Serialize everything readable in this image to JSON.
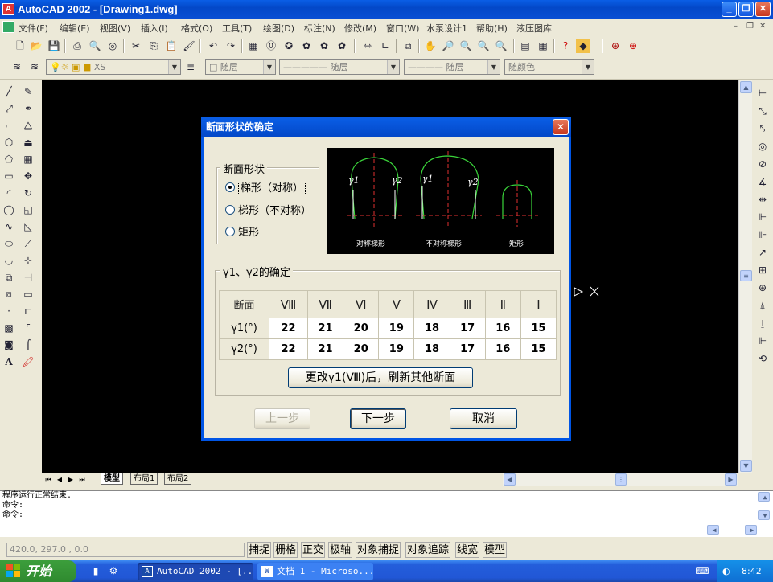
{
  "window": {
    "title": "AutoCAD 2002 - [Drawing1.dwg]",
    "app_icon": "A"
  },
  "menu": [
    "文件(F)",
    "编辑(E)",
    "视图(V)",
    "插入(I)",
    "格式(O)",
    "工具(T)",
    "绘图(D)",
    "标注(N)",
    "修改(M)",
    "窗口(W)",
    "水泵设计1",
    "帮助(H)",
    "液压图库"
  ],
  "layer_toolbar": {
    "layer_combo": "XS",
    "color_combo": "随层",
    "linetype_combo": "随层",
    "lineweight_combo": "随层",
    "plotstyle_combo": "随颜色"
  },
  "layout_tabs": [
    "模型",
    "布局1",
    "布局2"
  ],
  "command_lines": [
    "程序运行正常结束.",
    "命令:",
    "命令:"
  ],
  "status": {
    "coords": "420.0, 297.0 , 0.0",
    "toggles": [
      "捕捉",
      "栅格",
      "正交",
      "极轴",
      "对象捕捉",
      "对象追踪",
      "线宽",
      "模型"
    ]
  },
  "taskbar": {
    "start": "开始",
    "tasks": [
      "AutoCAD 2002 - [...",
      "文档 1 - Microso..."
    ],
    "clock": "8:42"
  },
  "dialog": {
    "title": "断面形状的确定",
    "shape_group": "断面形状",
    "options": [
      "梯形（对称）",
      "梯形（不对称）",
      "矩形"
    ],
    "selected_index": 0,
    "preview_labels": [
      "对称梯形",
      "不对称梯形",
      "矩形"
    ],
    "preview_angle_labels": [
      "γ1",
      "γ2",
      "γ1",
      "γ2"
    ],
    "gamma_group": "γ1、γ2的确定",
    "table": {
      "corner": "断面",
      "columns": [
        "Ⅷ",
        "Ⅶ",
        "Ⅵ",
        "Ⅴ",
        "Ⅳ",
        "Ⅲ",
        "Ⅱ",
        "Ⅰ"
      ],
      "rows": [
        {
          "label": "γ1(°)",
          "values": [
            "22",
            "21",
            "20",
            "19",
            "18",
            "17",
            "16",
            "15"
          ]
        },
        {
          "label": "γ2(°)",
          "values": [
            "22",
            "21",
            "20",
            "19",
            "18",
            "17",
            "16",
            "15"
          ]
        }
      ]
    },
    "refresh_button": "更改γ1(Ⅷ)后，刷新其他断面",
    "prev_button": "上一步",
    "next_button": "下一步",
    "cancel_button": "取消"
  }
}
